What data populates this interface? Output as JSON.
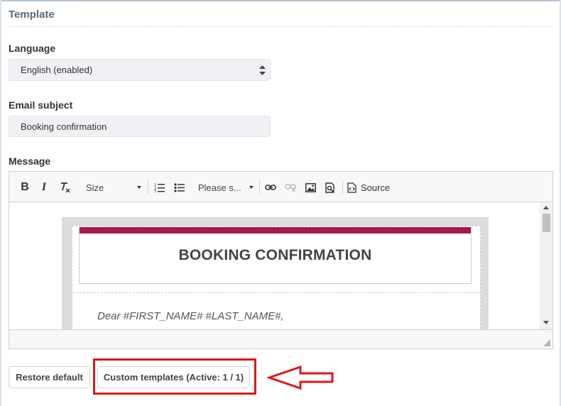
{
  "section": {
    "title": "Template"
  },
  "language": {
    "label": "Language",
    "selected": "English (enabled)"
  },
  "subject": {
    "label": "Email subject",
    "value": "Booking confirmation"
  },
  "message": {
    "label": "Message",
    "toolbar": {
      "bold": "B",
      "italic": "I",
      "size_label": "Size",
      "format_label": "Please s...",
      "source_label": "Source"
    },
    "content": {
      "email_title": "BOOKING CONFIRMATION",
      "greeting": "Dear #FIRST_NAME# #LAST_NAME#,",
      "band_color": "#a91a4a"
    }
  },
  "buttons": {
    "restore": "Restore default",
    "custom": "Custom templates (Active: 1 / 1)"
  },
  "annotation": {
    "color": "#e0171e"
  }
}
